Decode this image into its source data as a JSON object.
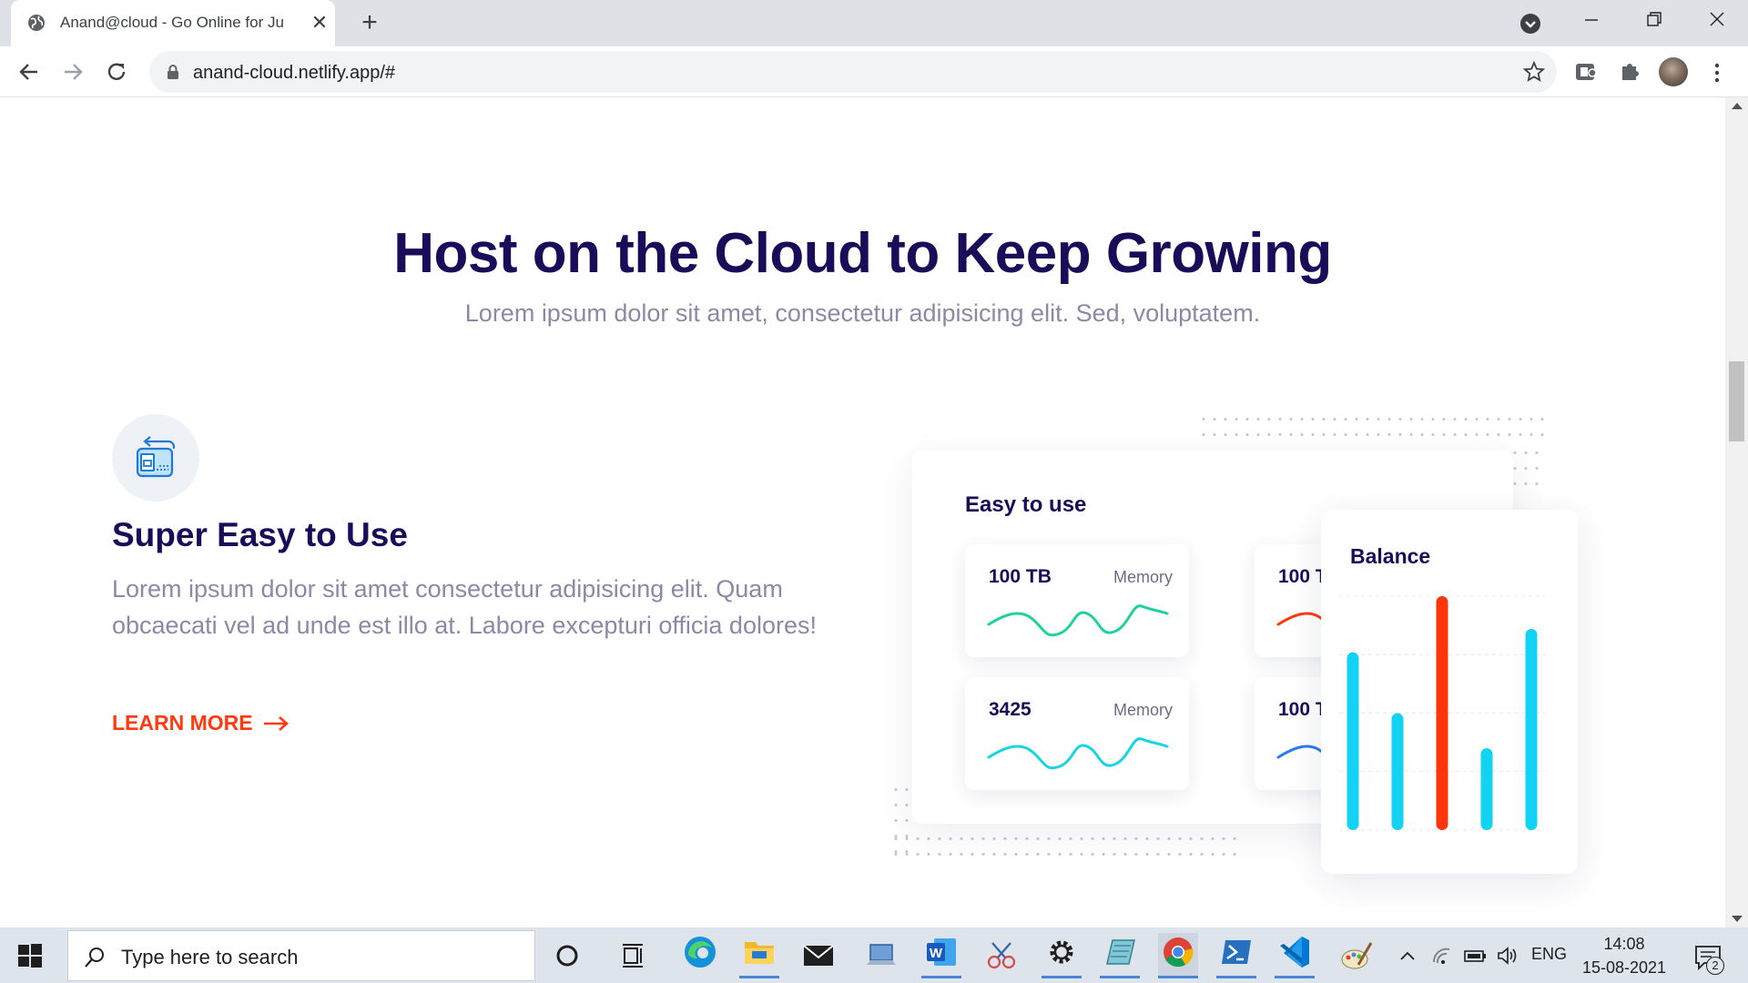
{
  "browser": {
    "tab_title": "Anand@cloud - Go Online for Ju",
    "url": "anand-cloud.netlify.app/#",
    "icons": [
      "globe-icon",
      "close-icon",
      "plus-icon",
      "tab-search-icon",
      "minimize-icon",
      "restore-icon",
      "close-window-icon",
      "back-arrow-icon",
      "forward-arrow-icon",
      "reload-icon",
      "lock-icon",
      "star-icon",
      "extension-icon",
      "puzzle-icon",
      "avatar",
      "more-vert-icon"
    ]
  },
  "hero": {
    "title": "Host on the Cloud to Keep Growing",
    "subtitle": "Lorem ipsum dolor sit amet, consectetur adipisicing elit. Sed, voluptatem."
  },
  "feature": {
    "title": "Super Easy to Use",
    "description": "Lorem ipsum dolor sit amet consectetur adipisicing elit. Quam obcaecati vel ad unde est illo at. Labore excepturi officia dolores!",
    "cta_label": "LEARN MORE",
    "cta_arrow": "→",
    "icon": "server-transfer-icon"
  },
  "illustration": {
    "main_card_title": "Easy to use",
    "stats": [
      {
        "value": "100 TB",
        "label": "Memory",
        "wave_color": "#1fd1a1"
      },
      {
        "value": "3425",
        "label": "Memory",
        "wave_color": "#18d4e3"
      },
      {
        "value": "100 T",
        "label": "",
        "wave_color": "#ff3a0f"
      },
      {
        "value": "100 T",
        "label": "",
        "wave_color": "#2b7cf0"
      }
    ],
    "balance_title": "Balance"
  },
  "chart_data": {
    "type": "bar",
    "title": "Balance",
    "values": [
      0.76,
      0.5,
      1.0,
      0.35,
      0.86
    ],
    "colors": [
      "#13d3f5",
      "#13d3f5",
      "#ff3408",
      "#13d3f5",
      "#13d3f5"
    ],
    "grid": true
  },
  "taskbar": {
    "search_placeholder": "Type here to search",
    "language": "ENG",
    "time": "14:08",
    "date": "15-08-2021",
    "notification_count": "2",
    "apps": [
      "cortana-icon",
      "task-view-icon",
      "edge-icon",
      "file-explorer-icon",
      "mail-icon",
      "laptop-icon",
      "word-icon",
      "snipping-icon",
      "settings-icon",
      "notepad-icon",
      "chrome-icon",
      "powershell-icon",
      "vscode-icon",
      "paint-icon"
    ]
  },
  "colors": {
    "heading": "#1b0c5a",
    "muted_text": "#8d88a6",
    "accent": "#ff3a0f",
    "bar_cyan": "#13d3f5"
  }
}
